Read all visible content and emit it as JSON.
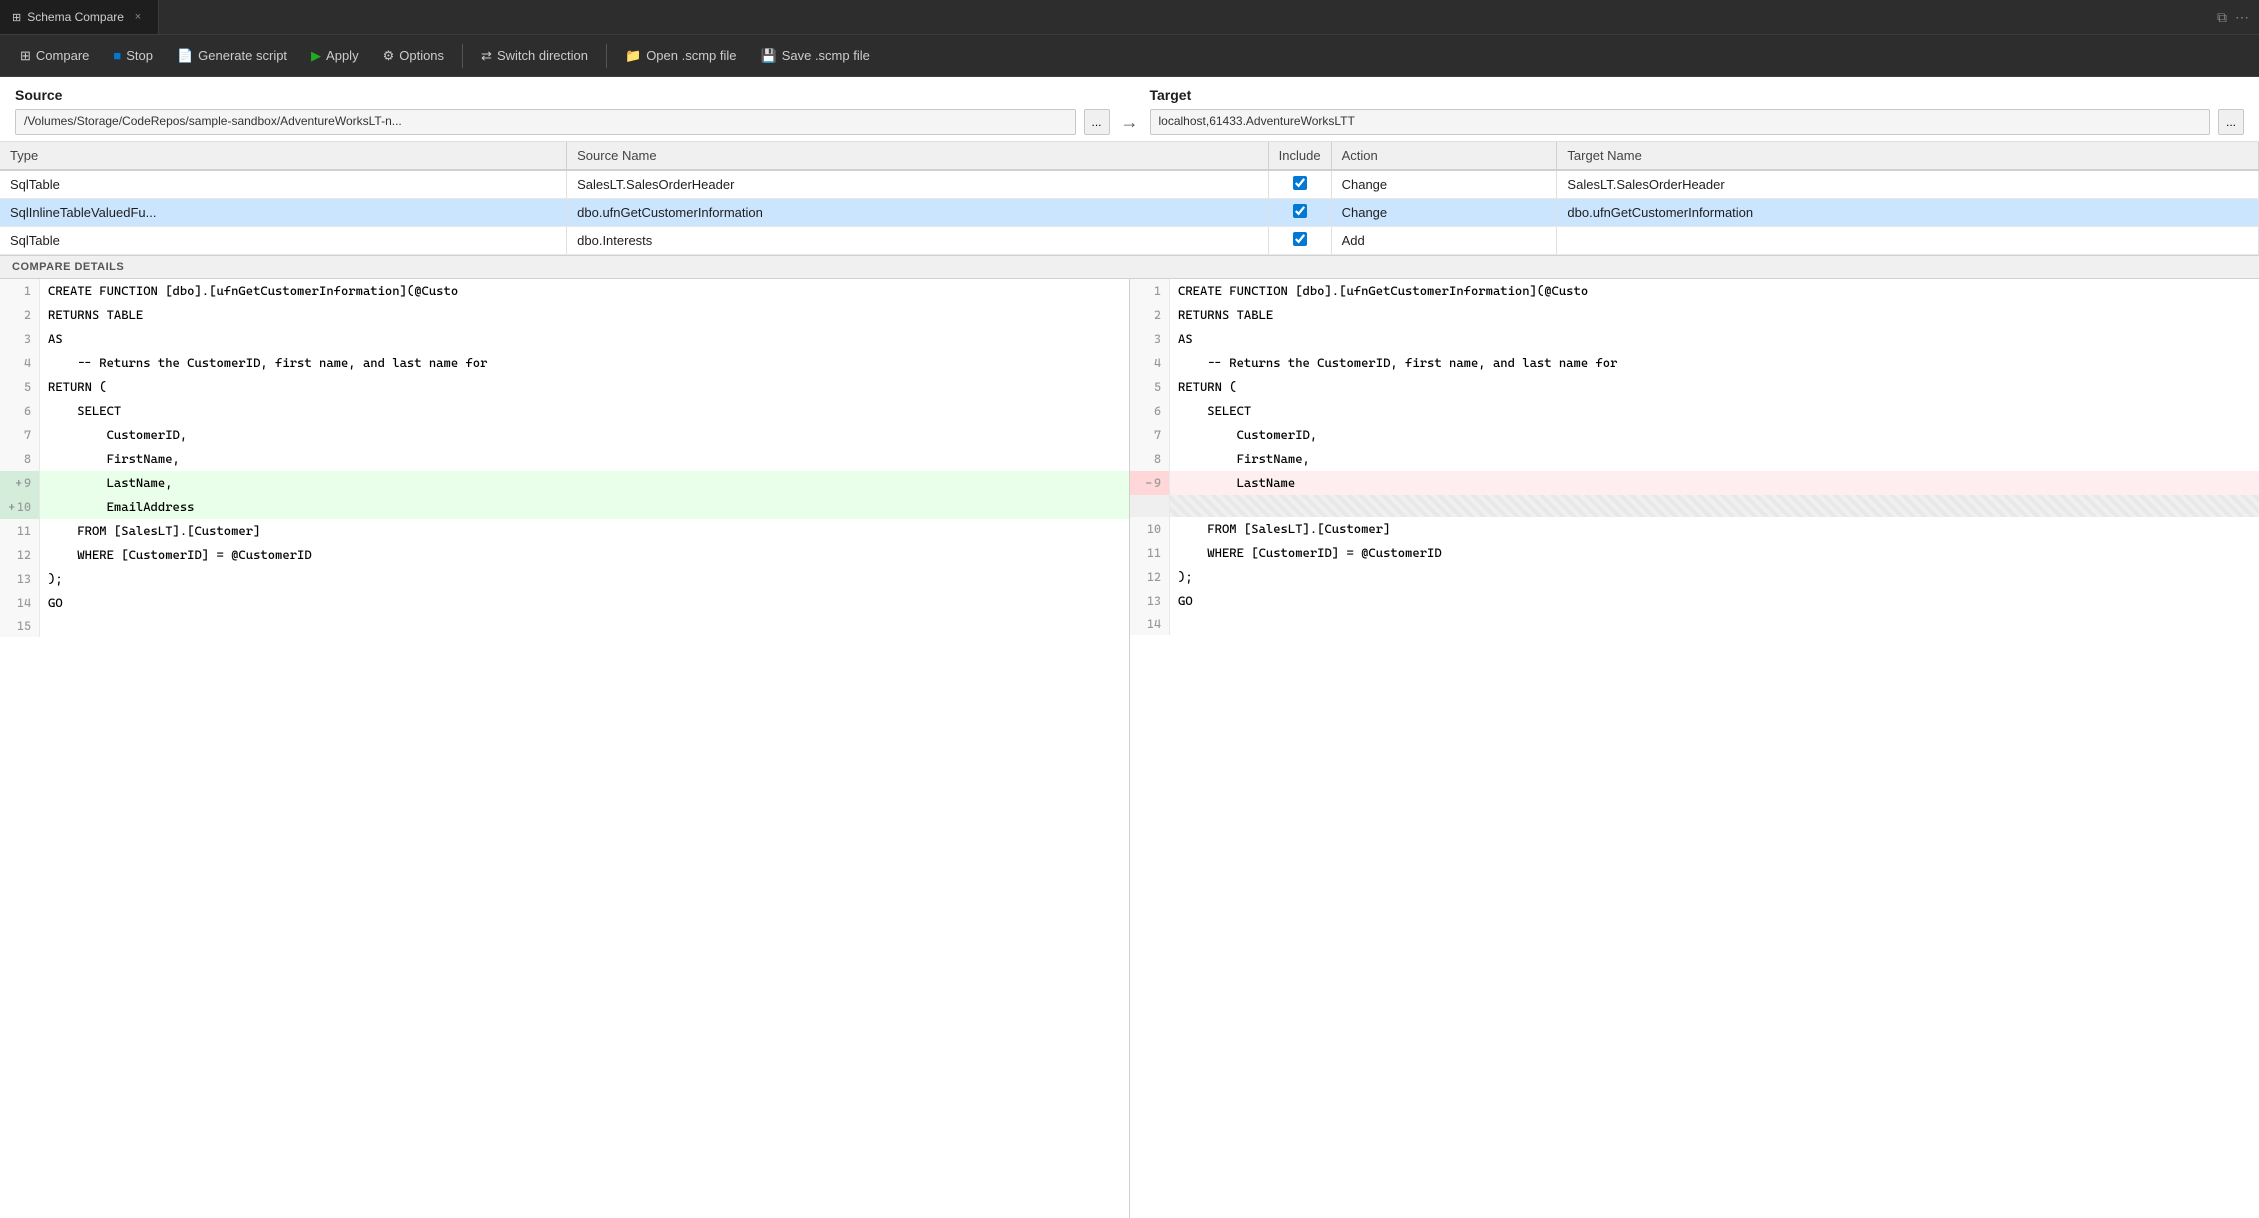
{
  "tab": {
    "icon": "⊞",
    "title": "Schema Compare",
    "close_label": "×"
  },
  "tab_actions": {
    "split_icon": "⧉",
    "more_icon": "⋯"
  },
  "toolbar": {
    "compare_label": "Compare",
    "stop_label": "Stop",
    "generate_script_label": "Generate script",
    "apply_label": "Apply",
    "options_label": "Options",
    "switch_direction_label": "Switch direction",
    "open_scmp_label": "Open .scmp file",
    "save_scmp_label": "Save .scmp file"
  },
  "source": {
    "label": "Source",
    "path": "/Volumes/Storage/CodeRepos/sample-sandbox/AdventureWorksLT-n...",
    "more_btn": "..."
  },
  "target": {
    "label": "Target",
    "path": "localhost,61433.AdventureWorksLTT",
    "more_btn": "..."
  },
  "table": {
    "columns": [
      "Type",
      "Source Name",
      "Include",
      "Action",
      "Target Name"
    ],
    "rows": [
      {
        "type": "SqlTable",
        "source_name": "SalesLT.SalesOrderHeader",
        "include": true,
        "action": "Change",
        "target_name": "SalesLT.SalesOrderHeader",
        "selected": false
      },
      {
        "type": "SqlInlineTableValuedFu...",
        "source_name": "dbo.ufnGetCustomerInformation",
        "include": true,
        "action": "Change",
        "target_name": "dbo.ufnGetCustomerInformation",
        "selected": true
      },
      {
        "type": "SqlTable",
        "source_name": "dbo.Interests",
        "include": true,
        "action": "Add",
        "target_name": "",
        "selected": false
      }
    ]
  },
  "compare_details_label": "COMPARE DETAILS",
  "diff": {
    "left": [
      {
        "num": 1,
        "marker": "",
        "content": "CREATE FUNCTION [dbo].[ufnGetCustomerInformation](@Custo",
        "type": "normal"
      },
      {
        "num": 2,
        "marker": "",
        "content": "RETURNS TABLE",
        "type": "normal"
      },
      {
        "num": 3,
        "marker": "",
        "content": "AS",
        "type": "normal"
      },
      {
        "num": 4,
        "marker": "",
        "content": "    -- Returns the CustomerID, first name, and last name for",
        "type": "normal"
      },
      {
        "num": 5,
        "marker": "",
        "content": "RETURN (",
        "type": "normal"
      },
      {
        "num": 6,
        "marker": "",
        "content": "    SELECT",
        "type": "normal"
      },
      {
        "num": 7,
        "marker": "",
        "content": "        CustomerID,",
        "type": "normal"
      },
      {
        "num": 8,
        "marker": "",
        "content": "        FirstName,",
        "type": "normal"
      },
      {
        "num": 9,
        "marker": "+",
        "content": "        LastName,",
        "type": "add"
      },
      {
        "num": 10,
        "marker": "+",
        "content": "        EmailAddress",
        "type": "add"
      },
      {
        "num": 11,
        "marker": "",
        "content": "    FROM [SalesLT].[Customer]",
        "type": "normal"
      },
      {
        "num": 12,
        "marker": "",
        "content": "    WHERE [CustomerID] = @CustomerID",
        "type": "normal"
      },
      {
        "num": 13,
        "marker": "",
        "content": ");",
        "type": "normal"
      },
      {
        "num": 14,
        "marker": "",
        "content": "GO",
        "type": "normal"
      },
      {
        "num": 15,
        "marker": "",
        "content": "",
        "type": "normal"
      }
    ],
    "right": [
      {
        "num": 1,
        "marker": "",
        "content": "CREATE FUNCTION [dbo].[ufnGetCustomerInformation](@Custo",
        "type": "normal"
      },
      {
        "num": 2,
        "marker": "",
        "content": "RETURNS TABLE",
        "type": "normal"
      },
      {
        "num": 3,
        "marker": "",
        "content": "AS",
        "type": "normal"
      },
      {
        "num": 4,
        "marker": "",
        "content": "    -- Returns the CustomerID, first name, and last name for",
        "type": "normal"
      },
      {
        "num": 5,
        "marker": "",
        "content": "RETURN (",
        "type": "normal"
      },
      {
        "num": 6,
        "marker": "",
        "content": "    SELECT",
        "type": "normal"
      },
      {
        "num": 7,
        "marker": "",
        "content": "        CustomerID,",
        "type": "normal"
      },
      {
        "num": 8,
        "marker": "",
        "content": "        FirstName,",
        "type": "normal"
      },
      {
        "num": 9,
        "marker": "-",
        "content": "        LastName",
        "type": "remove"
      },
      {
        "num": -1,
        "marker": "",
        "content": "",
        "type": "empty"
      },
      {
        "num": 10,
        "marker": "",
        "content": "    FROM [SalesLT].[Customer]",
        "type": "normal"
      },
      {
        "num": 11,
        "marker": "",
        "content": "    WHERE [CustomerID] = @CustomerID",
        "type": "normal"
      },
      {
        "num": 12,
        "marker": "",
        "content": ");",
        "type": "normal"
      },
      {
        "num": 13,
        "marker": "",
        "content": "GO",
        "type": "normal"
      },
      {
        "num": 14,
        "marker": "",
        "content": "",
        "type": "normal"
      }
    ]
  }
}
